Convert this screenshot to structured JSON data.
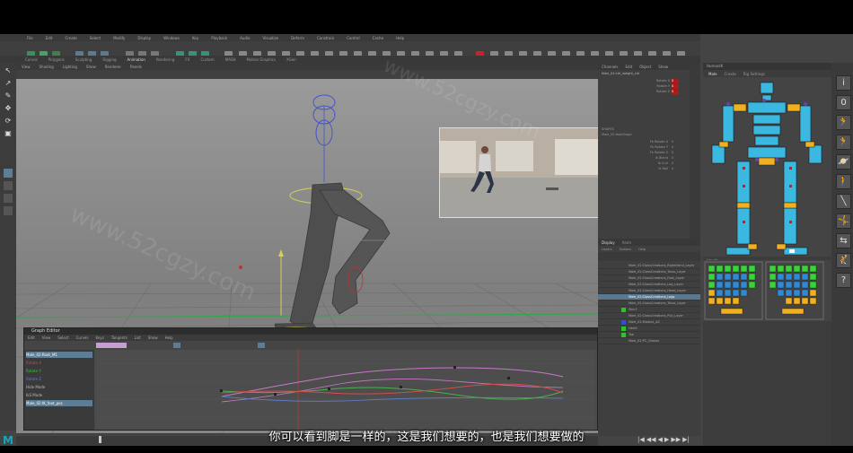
{
  "menubar": {
    "items": [
      "File",
      "Edit",
      "Create",
      "Select",
      "Modify",
      "Display",
      "Windows",
      "Key",
      "Playback",
      "Audio",
      "Visualize",
      "Deform",
      "Constrain",
      "Control",
      "Cache",
      "Help"
    ]
  },
  "shelf": {
    "tabs": [
      "Curves",
      "Polygons",
      "Sculpting",
      "Rigging",
      "Animation",
      "Rendering",
      "FX",
      "Custom",
      "MASH",
      "Motion Graphics",
      "XGen"
    ],
    "active_tab": "Animation"
  },
  "viewport": {
    "menu": [
      "View",
      "Shading",
      "Lighting",
      "Show",
      "Renderer",
      "Panels"
    ]
  },
  "graph_editor": {
    "title": "Graph Editor",
    "menu": [
      "Edit",
      "View",
      "Select",
      "Curves",
      "Keys",
      "Tangents",
      "List",
      "Show",
      "Help"
    ],
    "outliner_rows": [
      {
        "label": "Male_02:Root_M1",
        "selected": true
      },
      {
        "label": "Rotate X",
        "selected": false
      },
      {
        "label": "Rotate Y",
        "selected": false
      },
      {
        "label": "Rotate Z",
        "selected": false
      },
      {
        "label": "Hide Mode",
        "selected": false
      },
      {
        "label": "IkS Mode",
        "selected": false
      },
      {
        "label": "Male_02:IK_foot_pos",
        "selected": true
      }
    ]
  },
  "channel_box": {
    "tabs": [
      "Channels",
      "Edit",
      "Object",
      "Show"
    ],
    "node": "Male_02:ctrl_weight_ctrl",
    "attrs": [
      {
        "name": "Rotate X",
        "value": "0"
      },
      {
        "name": "Rotate Y",
        "value": "0"
      },
      {
        "name": "Rotate Z",
        "value": "0"
      }
    ],
    "shapes_label": "SHAPES",
    "shape_node": "Male_02:footShape",
    "shape_attrs": [
      {
        "name": "Fk Rotate X",
        "value": "0"
      },
      {
        "name": "Fk Rotate Y",
        "value": "0"
      },
      {
        "name": "Fk Rotate Z",
        "value": "0"
      },
      {
        "name": "Ik Blend",
        "value": "0"
      },
      {
        "name": "Ik Curl",
        "value": "0"
      },
      {
        "name": "Ik Roll",
        "value": "0"
      }
    ]
  },
  "layer_editor": {
    "tabs": [
      "Display",
      "Anim"
    ],
    "subtabs": [
      "Layers",
      "Options",
      "Help"
    ],
    "layers": [
      {
        "name": "Male_02:ClassCreations_RightHand_Layer",
        "color": "#3e3e3e",
        "selected": false
      },
      {
        "name": "Male_02:ClassCreations_Torso_Layer",
        "color": "#3e3e3e",
        "selected": false
      },
      {
        "name": "Male_02:ClassCreations_Foot_Layer",
        "color": "#3e3e3e",
        "selected": false
      },
      {
        "name": "Male_02:ClassCreations_Leg_Layer",
        "color": "#3e3e3e",
        "selected": false
      },
      {
        "name": "Male_02:ClassCreations_Head_Layer",
        "color": "#3e3e3e",
        "selected": false
      },
      {
        "name": "Male_02:ClassCreations_Legs",
        "color": "#3e3e3e",
        "selected": true
      },
      {
        "name": "Male_02:ClassCreations_Torso_Layer",
        "color": "#3e3e3e",
        "selected": false
      },
      {
        "name": "Skin1",
        "color": "#2ec22e",
        "selected": false
      },
      {
        "name": "Male_02:ClassCreations_Pull_Layer",
        "color": "#3e3e3e",
        "selected": false
      },
      {
        "name": "Male_02:Module_A2",
        "color": "#2f4fd8",
        "selected": false
      },
      {
        "name": "Heel1",
        "color": "#2ec22e",
        "selected": false
      },
      {
        "name": "Toe",
        "color": "#2ec22e",
        "selected": false
      },
      {
        "name": "Male_02:PC_Ghosts",
        "color": "#3e3e3e",
        "selected": false
      }
    ]
  },
  "hik": {
    "title": "HumanIK",
    "tabs": [
      "Male",
      "Create",
      "Rig Settings"
    ],
    "hands_label": "Hands"
  },
  "side_buttons": [
    "i",
    "0",
    "run-icon",
    "run-icon",
    "effector-icon",
    "walk-icon",
    "joint-icon",
    "arm-icon",
    "pose-icon",
    "ik-icon",
    "?"
  ],
  "subtitle": "你可以看到脚是一样的，这是我们想要的，也是我们想要做的",
  "watermark": "www.52cgzy.com",
  "colors": {
    "hik_body": "#3bb8df",
    "hik_joint": "#f0b020",
    "hik_fk": "#c02020",
    "hand_green": "#39d43a",
    "hand_blue": "#2e8ad6",
    "curve_pink": "#c679c9",
    "curve_green": "#4caf50",
    "curve_red": "#d14c4c",
    "curve_blue": "#6080d0"
  },
  "playback": {
    "controls": [
      "|◀",
      "◀◀",
      "◀",
      "▶",
      "▶▶",
      "▶|"
    ]
  }
}
